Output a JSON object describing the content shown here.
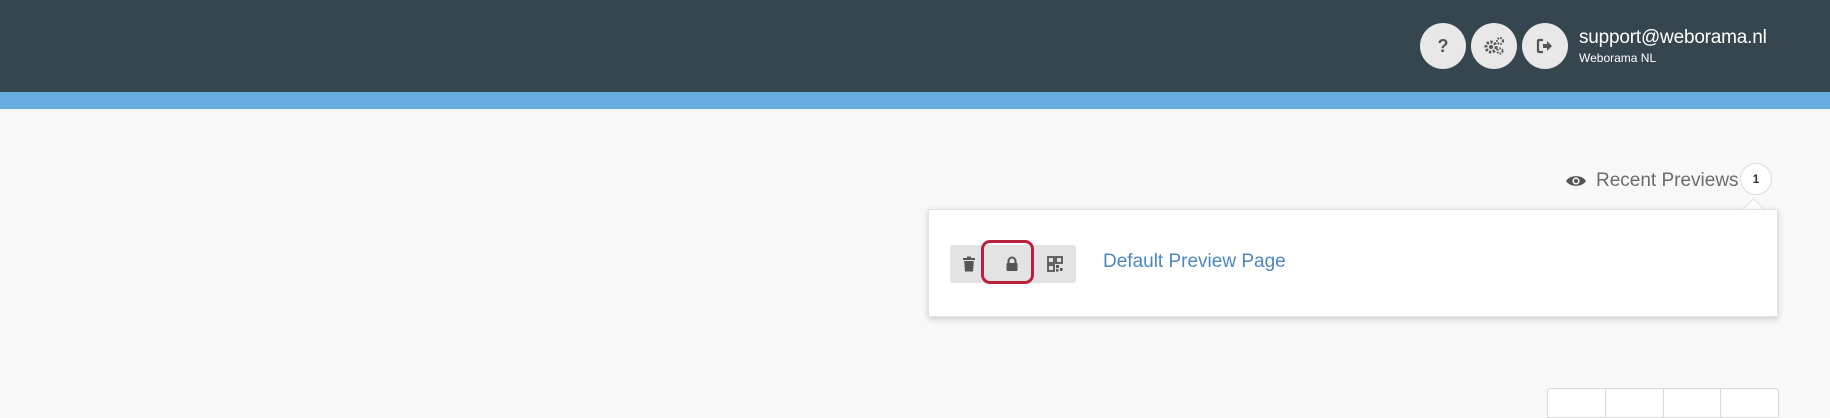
{
  "header": {
    "help_icon": "question-icon",
    "settings_icon": "gears-icon",
    "logout_icon": "sign-out-icon",
    "user": {
      "email": "support@weborama.nl",
      "organization": "Weborama NL"
    }
  },
  "recent_previews": {
    "label": "Recent Previews",
    "count": "1",
    "icon": "eye-icon",
    "items": [
      {
        "title": "Default Preview Page",
        "actions": [
          "trash-icon",
          "lock-icon",
          "qr-code-icon"
        ]
      }
    ]
  },
  "colors": {
    "topbar": "#36464f",
    "accent_strip": "#66ade0",
    "link": "#4d87bf",
    "highlight": "#b8213d"
  }
}
